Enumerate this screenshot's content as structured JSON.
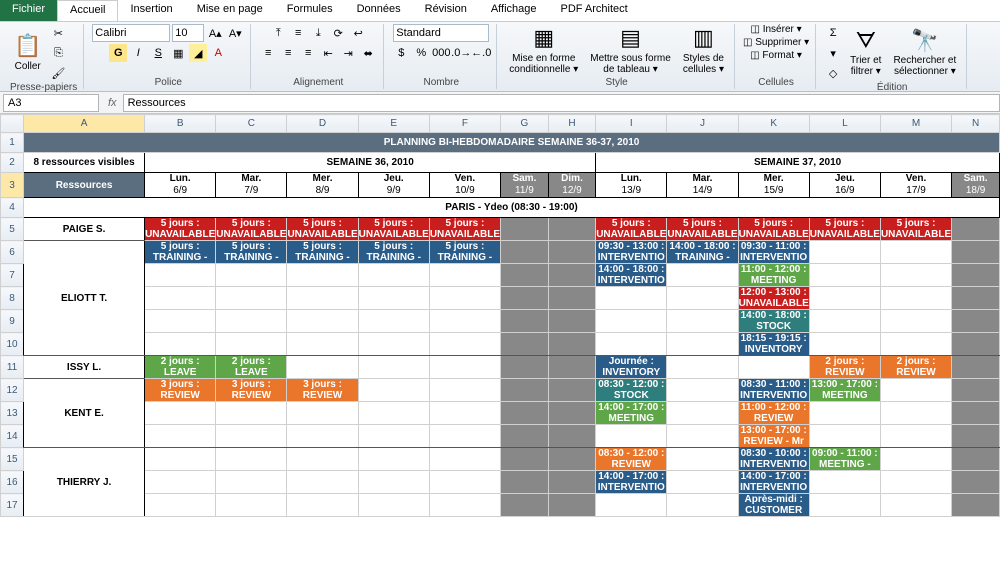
{
  "tabs": {
    "file": "Fichier",
    "home": "Accueil",
    "insert": "Insertion",
    "layout": "Mise en page",
    "formulas": "Formules",
    "data": "Données",
    "review": "Révision",
    "view": "Affichage",
    "pdf": "PDF Architect"
  },
  "groups": {
    "clipboard": "Presse-papiers",
    "font": "Police",
    "align": "Alignement",
    "number": "Nombre",
    "style": "Style",
    "cells": "Cellules",
    "edit": "Édition"
  },
  "btn": {
    "paste": "Coller",
    "condfmt": "Mise en forme\nconditionnelle ▾",
    "tablefmt": "Mettre sous forme\nde tableau ▾",
    "cellstyles": "Styles de\ncellules ▾",
    "insert": "◫ Insérer ▾",
    "delete": "◫ Supprimer ▾",
    "format": "◫ Format ▾",
    "sort": "Trier et\nfiltrer ▾",
    "find": "Rechercher et\nsélectionner ▾"
  },
  "font": {
    "name": "Calibri",
    "size": "10"
  },
  "numfmt": "Standard",
  "namebox": "A3",
  "formula": "Ressources",
  "cols": [
    "A",
    "B",
    "C",
    "D",
    "E",
    "F",
    "G",
    "H",
    "I",
    "J",
    "K",
    "L",
    "M",
    "N"
  ],
  "title": "PLANNING BI-HEBDOMADAIRE SEMAINE 36-37, 2010",
  "visible": "8 ressources visibles",
  "resources": "Ressources",
  "week36": "SEMAINE 36, 2010",
  "week37": "SEMAINE 37, 2010",
  "days": [
    {
      "d": "Lun.",
      "n": "6/9"
    },
    {
      "d": "Mar.",
      "n": "7/9"
    },
    {
      "d": "Mer.",
      "n": "8/9"
    },
    {
      "d": "Jeu.",
      "n": "9/9"
    },
    {
      "d": "Ven.",
      "n": "10/9"
    },
    {
      "d": "Sam.",
      "n": "11/9",
      "w": 1
    },
    {
      "d": "Dim.",
      "n": "12/9",
      "w": 1
    },
    {
      "d": "Lun.",
      "n": "13/9"
    },
    {
      "d": "Mar.",
      "n": "14/9"
    },
    {
      "d": "Mer.",
      "n": "15/9"
    },
    {
      "d": "Jeu.",
      "n": "16/9"
    },
    {
      "d": "Ven.",
      "n": "17/9"
    },
    {
      "d": "Sam.",
      "n": "18/9",
      "w": 1
    }
  ],
  "paris": "PARIS - Ydeo   (08:30 - 19:00)",
  "names": {
    "paige": "PAIGE S.",
    "eliott": "ELIOTT T.",
    "issy": "ISSY L.",
    "kent": "KENT E.",
    "thierry": "THIERRY J."
  },
  "ev": {
    "unavail5": "5 jours :\nUNAVAILABLE",
    "train": "5 jours :\nTRAINING -",
    "interv0930": "09:30 - 13:00 :\nINTERVENTIO",
    "interv1400": "14:00 - 18:00 :\nINTERVENTIO",
    "train1418": "14:00 - 18:00 :\nTRAINING -",
    "interv0911": "09:30 - 11:00 :\nINTERVENTIO",
    "meet1112": "11:00 - 12:00 :\nMEETING",
    "unavail1213": "12:00 - 13:00 :\nUNAVAILABLE",
    "stock1418": "14:00 - 18:00 :\nSTOCK",
    "inv1819": "18:15 - 19:15 :\nINVENTORY",
    "leave2": "2 jours :\nLEAVE",
    "review3": "3 jours :\nREVIEW",
    "journinv": "Journée :\nINVENTORY",
    "stock0812": "08:30 - 12:00 :\nSTOCK",
    "meet1417": "14:00 - 17:00 :\nMEETING",
    "interv0811": "08:30 - 11:00 :\nINTERVENTIO",
    "review1112": "11:00 - 12:00 :\nREVIEW",
    "reviewmr": "13:00 - 17:00 :\nREVIEW - Mr",
    "meet1317": "13:00 - 17:00 :\nMEETING",
    "review2": "2 jours :\nREVIEW",
    "review0812": "08:30 - 12:00 :\nREVIEW",
    "interv1417": "14:00 - 17:00 :\nINTERVENTIO",
    "interv0810": "08:30 - 10:00 :\nINTERVENTIO",
    "customer": "Après-midi :\nCUSTOMER",
    "meet0911": "09:00 - 11:00 :\nMEETING -"
  }
}
